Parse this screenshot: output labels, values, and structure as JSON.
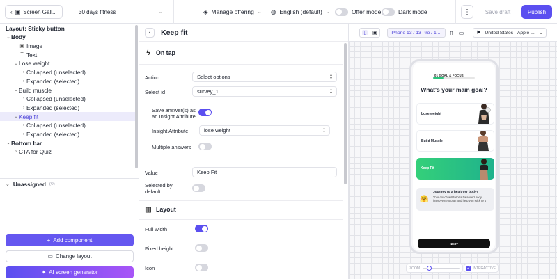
{
  "topbar": {
    "screen_button": "Screen Gall...",
    "flow_name": "30 days fitness",
    "manage_offering": "Manage offering",
    "language": "English (default)",
    "offer_mode": "Offer mode",
    "dark_mode": "Dark mode",
    "save_draft": "Save draft",
    "publish": "Publish"
  },
  "left": {
    "layout_title": "Layout: Sticky button",
    "tree": [
      {
        "label": "Body",
        "caret": "⌄",
        "icon": "",
        "indent": 0,
        "bold": true
      },
      {
        "label": "Image",
        "caret": "",
        "icon": "▣",
        "indent": 1,
        "bold": false
      },
      {
        "label": "Text",
        "caret": "",
        "icon": "T",
        "indent": 1,
        "bold": false
      },
      {
        "label": "Lose weight",
        "caret": "⌄",
        "icon": "",
        "indent": 1,
        "bold": false
      },
      {
        "label": "Collapsed (unselected)",
        "caret": "›",
        "icon": "",
        "indent": 2,
        "bold": false
      },
      {
        "label": "Expanded (selected)",
        "caret": "›",
        "icon": "",
        "indent": 2,
        "bold": false
      },
      {
        "label": "Build muscle",
        "caret": "⌄",
        "icon": "",
        "indent": 1,
        "bold": false
      },
      {
        "label": "Collapsed (unselected)",
        "caret": "›",
        "icon": "",
        "indent": 2,
        "bold": false
      },
      {
        "label": "Expanded (selected)",
        "caret": "›",
        "icon": "",
        "indent": 2,
        "bold": false
      },
      {
        "label": "Keep fit",
        "caret": "⌄",
        "icon": "",
        "indent": 1,
        "bold": false,
        "selected": true
      },
      {
        "label": "Collapsed (unselected)",
        "caret": "›",
        "icon": "",
        "indent": 2,
        "bold": false
      },
      {
        "label": "Expanded (selected)",
        "caret": "›",
        "icon": "",
        "indent": 2,
        "bold": false
      },
      {
        "label": "Bottom bar",
        "caret": "⌄",
        "icon": "",
        "indent": 0,
        "bold": true
      },
      {
        "label": "CTA for Quiz",
        "caret": "›",
        "icon": "",
        "indent": 1,
        "bold": false
      }
    ],
    "unassigned": "Unassigned",
    "unassigned_count": "(0)",
    "add_component": "Add component",
    "change_layout": "Change layout",
    "ai_generator": "AI screen generator"
  },
  "mid": {
    "title": "Keep fit",
    "on_tap": "On tap",
    "action_label": "Action",
    "action_value": "Select options",
    "select_id_label": "Select id",
    "select_id_value": "survey_1",
    "save_answers_label": "Save answer(s) as an Insight Attribute",
    "insight_attr_label": "Insight Attribute",
    "insight_attr_value": "lose weight",
    "multiple_answers_label": "Multiple answers",
    "value_label": "Value",
    "value_value": "Keep Fit",
    "selected_default_label": "Selected by default",
    "layout": "Layout",
    "full_width": "Full width",
    "fixed_height": "Fixed height",
    "icon": "Icon"
  },
  "canvas": {
    "device": "iPhone 13 / 13 Pro / 1...",
    "country": "United States - Apple ...",
    "zoom_label": "ZOOM",
    "interactive_label": "INTERACTIVE"
  },
  "phone": {
    "goal_label": "01 GOAL & FOCUS",
    "progress": 0.25,
    "question": "What's your main goal?",
    "options": [
      "Lose weight",
      "Build Muscle",
      "Keep Fit"
    ],
    "tip_title": "Journey to a healthier body!",
    "tip_body": "Your coach will tailor a balanced body improvement plan and help you stick to it",
    "tip_emoji": "🤗",
    "next": "NEXT"
  },
  "colors": {
    "accent": "#5b4ff0",
    "selected_option": "#2ac37a"
  },
  "toggles": {
    "offer_mode": false,
    "dark_mode": false,
    "save_answers": true,
    "multiple_answers": false,
    "selected_default": false,
    "full_width": true,
    "fixed_height": false,
    "icon": false
  }
}
